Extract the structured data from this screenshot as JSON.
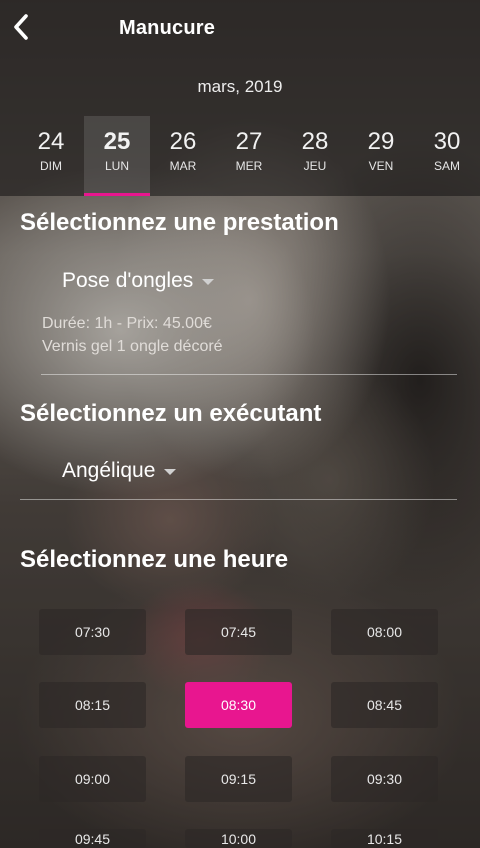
{
  "header": {
    "title": "Manucure",
    "month": "mars, 2019"
  },
  "dates": [
    {
      "day": "24",
      "dow": "DIM",
      "selected": false
    },
    {
      "day": "25",
      "dow": "LUN",
      "selected": true
    },
    {
      "day": "26",
      "dow": "MAR",
      "selected": false
    },
    {
      "day": "27",
      "dow": "MER",
      "selected": false
    },
    {
      "day": "28",
      "dow": "JEU",
      "selected": false
    },
    {
      "day": "29",
      "dow": "VEN",
      "selected": false
    },
    {
      "day": "30",
      "dow": "SAM",
      "selected": false
    }
  ],
  "service": {
    "title": "Sélectionnez une prestation",
    "selected": "Pose d'ongles",
    "details": "Durée: 1h - Prix: 45.00€",
    "description": "Vernis gel 1 ongle décoré"
  },
  "staff": {
    "title": "Sélectionnez un exécutant",
    "selected": "Angélique"
  },
  "time": {
    "title": "Sélectionnez une heure",
    "selected": "08:30",
    "slots": [
      "07:30",
      "07:45",
      "08:00",
      "08:15",
      "08:30",
      "08:45",
      "09:00",
      "09:15",
      "09:30",
      "09:45",
      "10:00",
      "10:15"
    ]
  },
  "icons": {
    "back": "chevron-left-icon",
    "dropdown": "caret-down-icon"
  },
  "colors": {
    "accent": "#e8168f"
  }
}
